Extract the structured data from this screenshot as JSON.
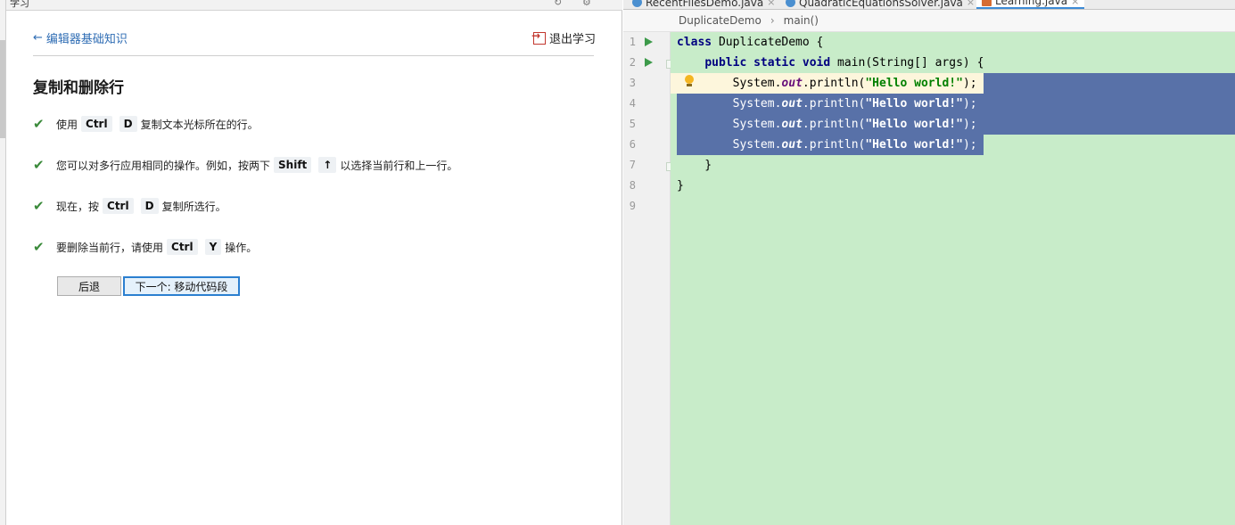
{
  "panel": {
    "title": "学习",
    "back_link": "编辑器基础知识",
    "exit_label": "退出学习",
    "lesson_title": "复制和删除行",
    "steps": [
      {
        "parts": [
          "使用",
          "Ctrl",
          "D",
          "复制文本光标所在的行。"
        ]
      },
      {
        "parts": [
          "您可以对多行应用相同的操作。例如，按两下",
          "Shift",
          "↑",
          "以选择当前行和上一行。"
        ]
      },
      {
        "parts": [
          "现在，按",
          "Ctrl",
          "D",
          "复制所选行。"
        ]
      },
      {
        "parts": [
          "要删除当前行，请使用",
          "Ctrl",
          "Y",
          "操作。"
        ]
      }
    ],
    "back_button": "后退",
    "next_button": "下一个: 移动代码段"
  },
  "editor": {
    "tabs": [
      {
        "label": "RecentFilesDemo.java",
        "icon": "class-icon"
      },
      {
        "label": "QuadraticEquationsSolver.java",
        "icon": "class-icon"
      },
      {
        "label": "Learning.java",
        "icon": "java-file-icon",
        "active": true
      }
    ],
    "breadcrumb": [
      "DuplicateDemo",
      "main()"
    ],
    "line_numbers": [
      "1",
      "2",
      "3",
      "4",
      "5",
      "6",
      "7",
      "8",
      "9"
    ],
    "code": {
      "l1_kw": "class",
      "l1_rest": " DuplicateDemo {",
      "l2_indent": "    ",
      "l2_kw": "public static void",
      "l2_rest": " main(String[] args) {",
      "stmt_indent": "        ",
      "stmt_prefix": "System.",
      "stmt_field": "out",
      "stmt_call": ".println(",
      "stmt_string": "\"Hello world!\"",
      "stmt_end": ");",
      "l7": "    }",
      "l8": "}"
    }
  },
  "colors": {
    "editor_bg": "#c8ecc9",
    "selection": "#5871a8",
    "caret_line": "#fdf6dc",
    "keyword": "#000080",
    "string": "#008000",
    "accent": "#2b7fd0"
  }
}
